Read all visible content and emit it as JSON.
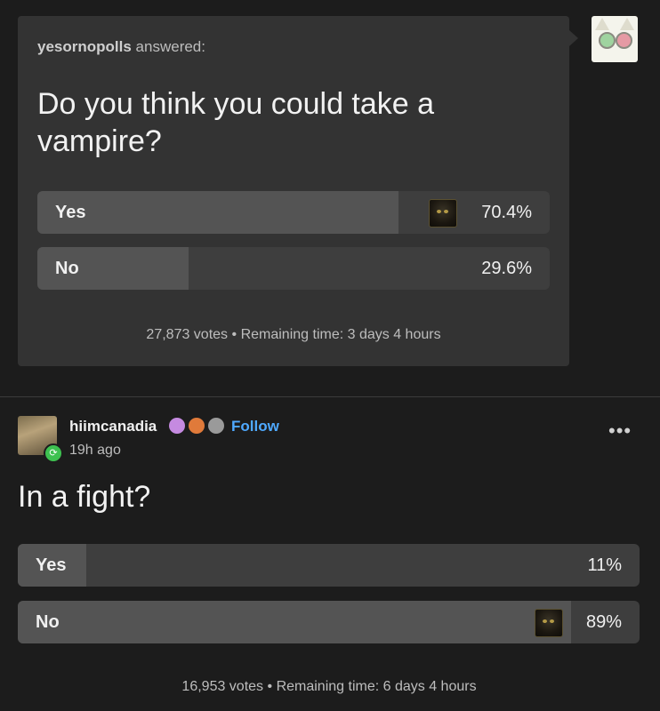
{
  "original_post": {
    "author": "yesornopolls",
    "answered_text": "answered:",
    "question": "Do you think you could take a vampire?",
    "options": [
      {
        "label": "Yes",
        "percent": "70.4%",
        "share": 70.4,
        "user_voted": true
      },
      {
        "label": "No",
        "percent": "29.6%",
        "share": 29.6,
        "user_voted": false
      }
    ],
    "votes": "27,873 votes",
    "separator": "•",
    "remaining": "Remaining time: 3 days 4 hours"
  },
  "reblog": {
    "username": "hiimcanadia",
    "follow_label": "Follow",
    "time": "19h ago",
    "more_icon": "ellipsis-icon",
    "question": "In a fight?",
    "options": [
      {
        "label": "Yes",
        "percent": "11%",
        "share": 11,
        "user_voted": false
      },
      {
        "label": "No",
        "percent": "89%",
        "share": 89,
        "user_voted": true
      }
    ],
    "votes": "16,953 votes",
    "separator": "•",
    "remaining": "Remaining time: 6 days 4 hours"
  },
  "colors": {
    "background": "#1c1c1c",
    "card": "#333333",
    "follow": "#4fa9ff",
    "reblog_badge": "#3ec150"
  }
}
